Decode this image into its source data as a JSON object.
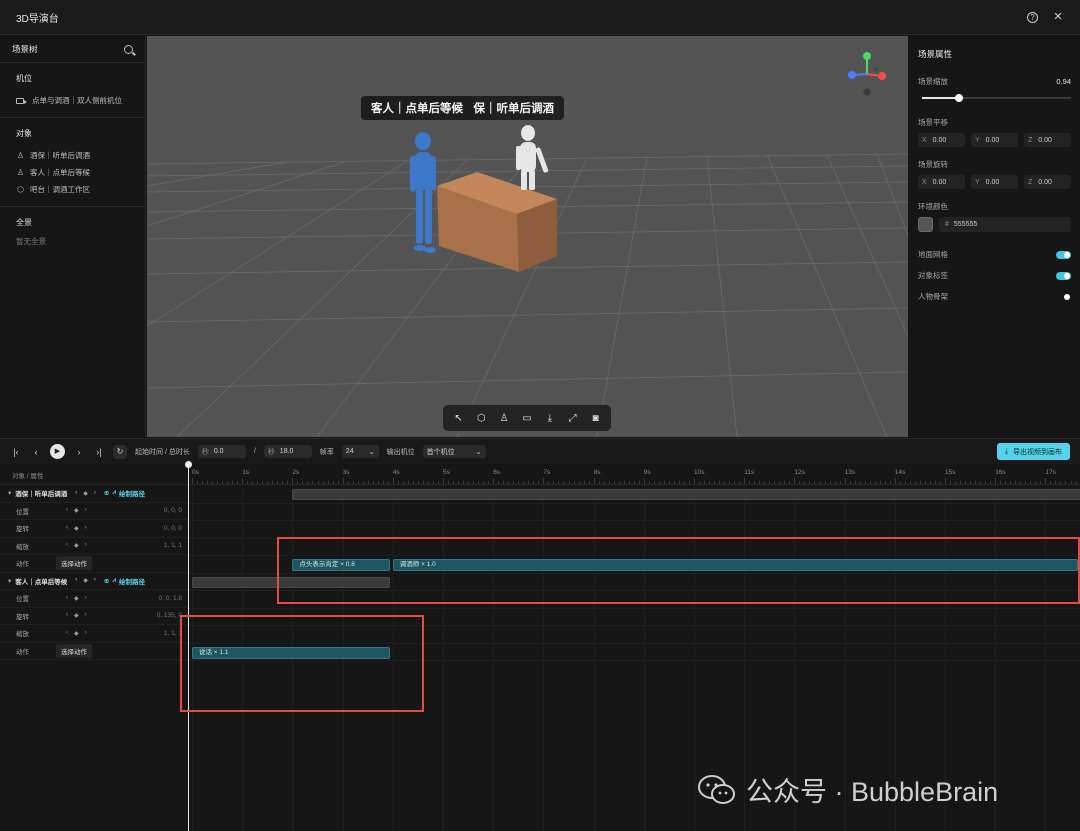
{
  "app": {
    "title": "3D导演台"
  },
  "scene_tree": {
    "title": "场景树",
    "cameras": {
      "title": "机位",
      "items": [
        {
          "label": "点单与调酒｜双人侧前机位"
        }
      ]
    },
    "objects": {
      "title": "对象",
      "items": [
        {
          "label": "酒保｜听单后调酒",
          "icon": "person-icon"
        },
        {
          "label": "客人｜点单后等候",
          "icon": "person-icon"
        },
        {
          "label": "吧台｜调酒工作区",
          "icon": "cube-icon"
        }
      ]
    },
    "panorama": {
      "title": "全景",
      "empty": "暂无全景"
    }
  },
  "viewport": {
    "labels": {
      "customer": "客人｜点单后等候",
      "bartender": "酒保｜听单后调酒"
    },
    "background": "#545454",
    "figure_colors": {
      "customer": "#3d78c9",
      "bartender": "#e8e8e8",
      "counter": "#a8714a"
    },
    "toolbar": [
      "select-icon",
      "cube-icon",
      "person-icon",
      "camera-icon",
      "download-icon",
      "fullscreen-icon",
      "screenshot-icon"
    ]
  },
  "properties": {
    "title": "场景属性",
    "scale": {
      "label": "场景缩放",
      "value": "0.94",
      "fraction": 0.24
    },
    "translate": {
      "label": "场景平移",
      "x": "0.00",
      "y": "0.00",
      "z": "0.00"
    },
    "rotate": {
      "label": "场景旋转",
      "x": "0.00",
      "y": "0.00",
      "z": "0.00"
    },
    "env_color": {
      "label": "环境颜色",
      "hash": "#",
      "hex": "555555"
    },
    "toggles": [
      {
        "label": "地面网格",
        "on": true
      },
      {
        "label": "对象标签",
        "on": true
      },
      {
        "label": "人物骨架",
        "on": false
      }
    ],
    "axes": {
      "x": "X",
      "y": "Y",
      "z": "Z"
    }
  },
  "transport": {
    "time_label": "起始时间 / 总时长",
    "unit": "秒",
    "start": "0.0",
    "slash": "/",
    "duration": "18.0",
    "fps_label": "帧率",
    "fps": "24",
    "output_label": "输出机位",
    "output_camera": "首个机位",
    "export_label": "导出视频到画布"
  },
  "timeline": {
    "header_label": "对象 / 属性",
    "ticks": [
      "0s",
      "1s",
      "2s",
      "3s",
      "4s",
      "5s",
      "6s",
      "7s",
      "8s",
      "9s",
      "10s",
      "11s",
      "12s",
      "13s",
      "14s",
      "15s",
      "16s",
      "17s"
    ],
    "path_label": "绘制路径",
    "choose_action": "选择动作",
    "groups": [
      {
        "name": "酒保｜听单后调酒",
        "rows": [
          {
            "label": "位置",
            "value": "0, 0, 0"
          },
          {
            "label": "旋转",
            "value": "0, 0, 0"
          },
          {
            "label": "缩放",
            "value": "1, 1, 1"
          },
          {
            "label": "动作",
            "value": ""
          }
        ],
        "clips": [
          {
            "label": "点头表示肯定 × 0.8",
            "start": 2.0,
            "end": 3.95
          },
          {
            "label": "调酒师 × 1.0",
            "start": 4.0,
            "end": 18.0
          }
        ],
        "span": {
          "start": 2.0,
          "end": 18.0
        }
      },
      {
        "name": "客人｜点单后等候",
        "rows": [
          {
            "label": "位置",
            "value": "0, 0, 1.8"
          },
          {
            "label": "旋转",
            "value": "0, 135, 0"
          },
          {
            "label": "缩放",
            "value": "1, 1, 1"
          },
          {
            "label": "动作",
            "value": ""
          }
        ],
        "clips": [
          {
            "label": "说话 × 1.1",
            "start": 0.0,
            "end": 3.95
          }
        ],
        "span": {
          "start": 0.0,
          "end": 3.95
        }
      }
    ]
  },
  "watermark": {
    "text": "公众号 · BubbleBrain"
  }
}
